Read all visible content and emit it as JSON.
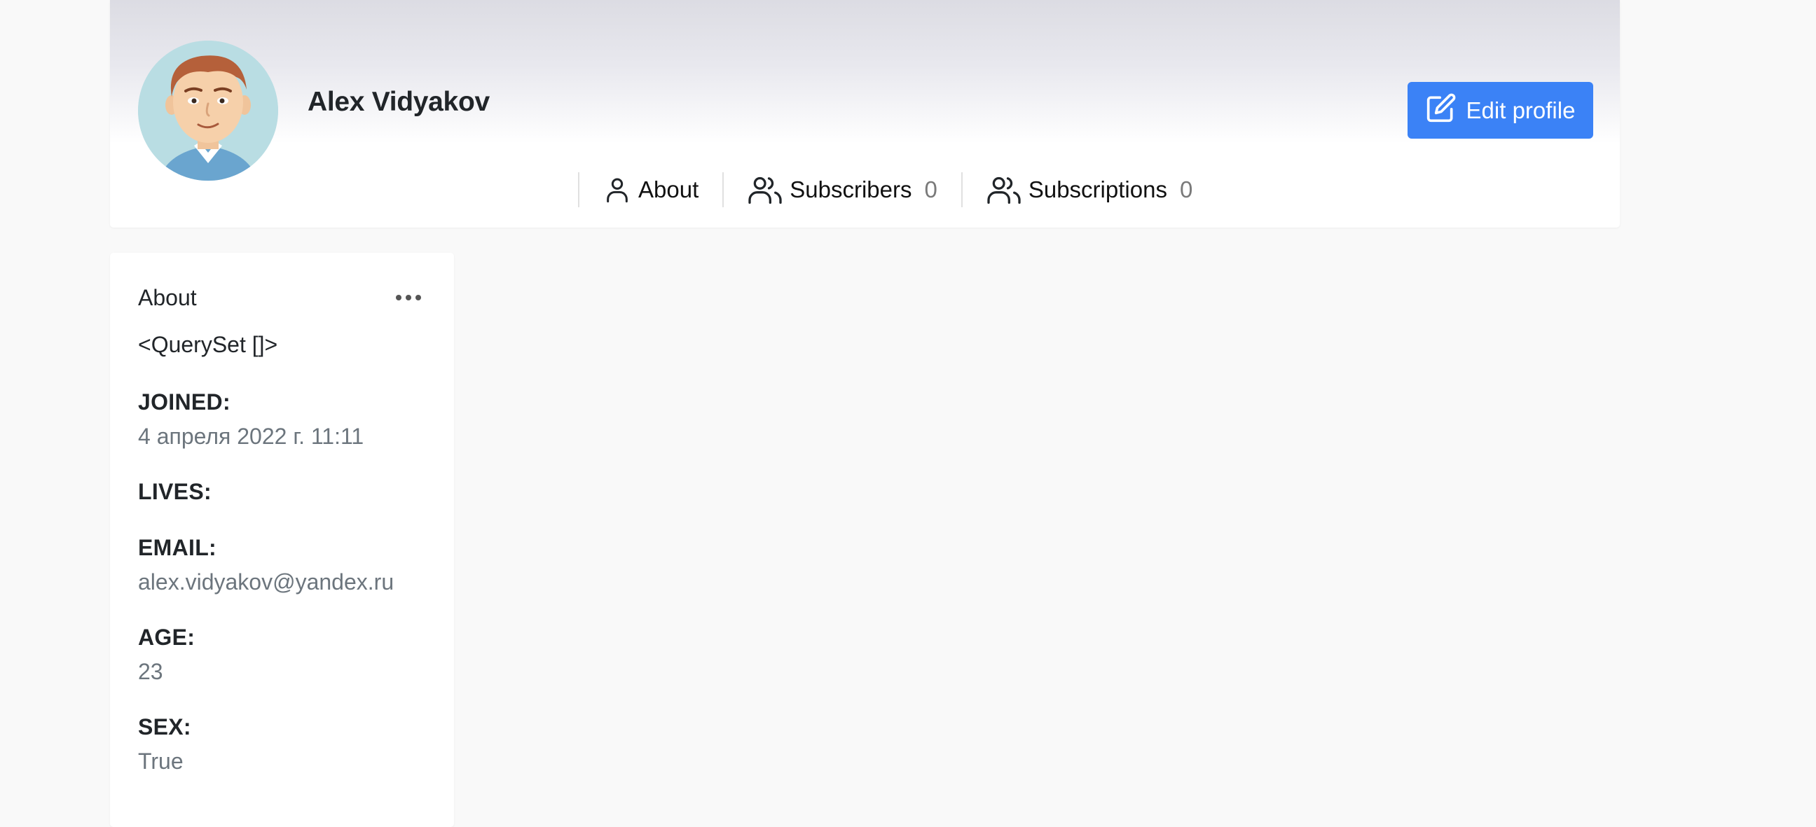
{
  "profile": {
    "name": "Alex Vidyakov",
    "edit_label": "Edit profile"
  },
  "tabs": [
    {
      "label": "About",
      "icon": "user-icon"
    },
    {
      "label": "Subscribers",
      "count": "0",
      "icon": "users-icon"
    },
    {
      "label": "Subscriptions",
      "count": "0",
      "icon": "users-icon"
    }
  ],
  "about": {
    "title": "About",
    "text": "<QuerySet []>",
    "fields": [
      {
        "label": "JOINED:",
        "value": "4 апреля 2022 г. 11:11"
      },
      {
        "label": "LIVES:",
        "value": ""
      },
      {
        "label": "EMAIL:",
        "value": "alex.vidyakov@yandex.ru"
      },
      {
        "label": "AGE:",
        "value": "23"
      },
      {
        "label": "SEX:",
        "value": "True"
      }
    ]
  },
  "colors": {
    "accent": "#3b82f6",
    "background": "#f9f9f9",
    "muted_text": "#6c757d"
  }
}
